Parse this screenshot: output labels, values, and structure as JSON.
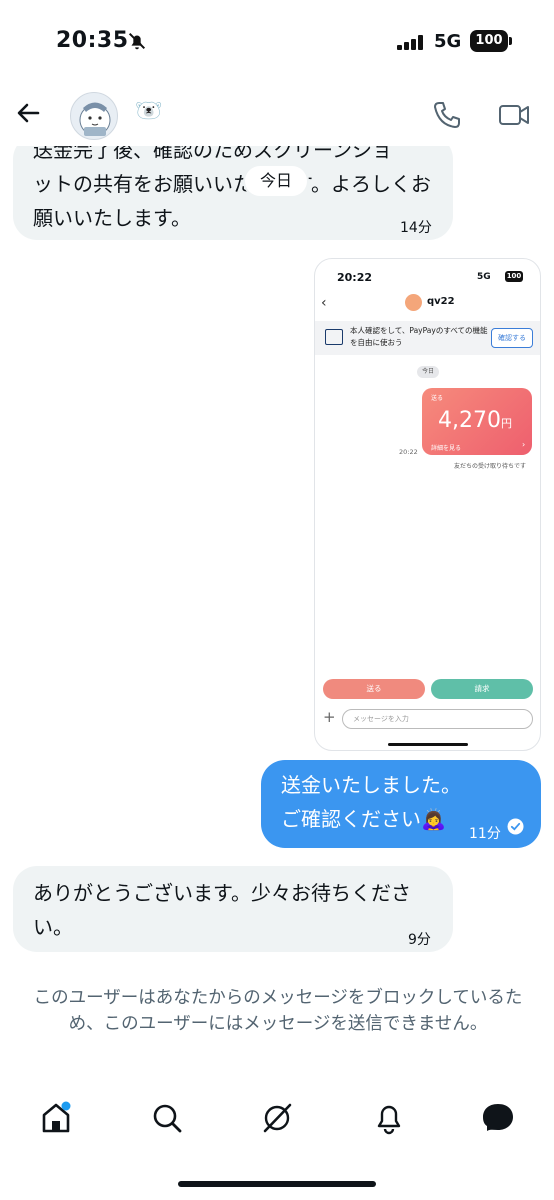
{
  "status_bar": {
    "time": "20:35",
    "network": "5G",
    "battery": "100"
  },
  "header": {
    "name_emoji": "🐻‍❄️"
  },
  "messages": [
    {
      "lines": [
        "送金完了後、確認のためスクリーンショ",
        "ットの共有をお願いいたします。よろしくお",
        "願いいたします。"
      ],
      "time": "14分",
      "date_chip": "今日"
    },
    {
      "lines": [
        "送金いたしました。",
        "ご確認ください"
      ],
      "emoji": "🙇‍♀️",
      "time": "11分"
    },
    {
      "lines": [
        "ありがとうございます。少々お待ちくださ",
        "い。"
      ],
      "time": "9分"
    }
  ],
  "screenshot": {
    "time": "20:22",
    "network": "5G",
    "battery": "100",
    "contact_name": "qv22",
    "banner_text": "本人確認をして、PayPayのすべての機能を自由に使おう",
    "banner_button": "確認する",
    "today": "今日",
    "card_label": "送る",
    "amount": "4,270",
    "currency": "円",
    "detail_link": "詳細を見る",
    "sent_time": "20:22",
    "status": "友だちの受け取り待ちです",
    "send_button": "送る",
    "request_button": "請求",
    "input_placeholder": "メッセージを入力"
  },
  "block_notice": "このユーザーはあなたからのメッセージをブロックしているため、このユーザーにはメッセージを送信できません。",
  "colors": {
    "outgoing_bubble": "#3b96f0",
    "incoming_bubble": "#eff3f4",
    "accent_dot": "#1d9bf0"
  },
  "tabs": [
    "home-icon",
    "search-icon",
    "grok-icon",
    "notifications-icon",
    "messages-icon"
  ]
}
